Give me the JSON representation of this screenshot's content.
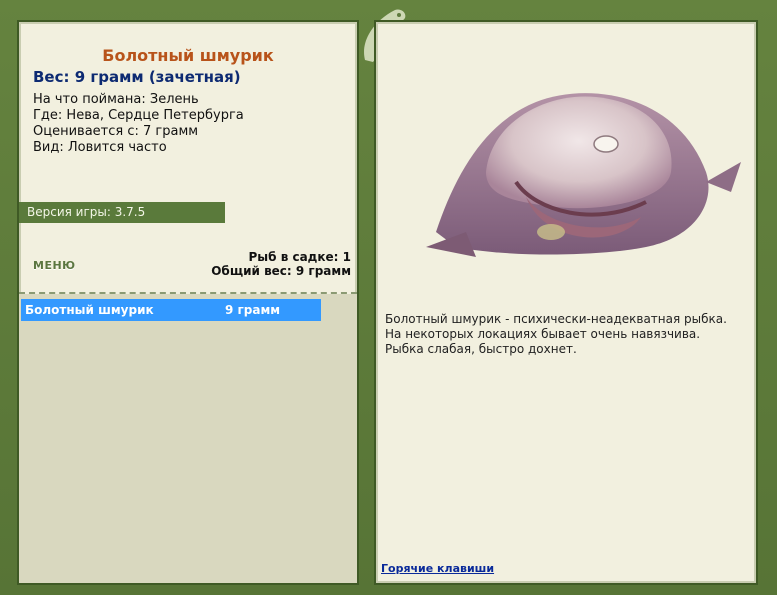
{
  "fish": {
    "title": "Болотный шмурик",
    "weight_line": "Вес: 9 грамм (зачетная)",
    "info": [
      "На что поймана: Зелень",
      "Где: Нева, Сердце Петербурга",
      "Оценивается с: 7 грамм",
      "Вид: Ловится часто"
    ]
  },
  "version": "Версия игры: 3.7.5",
  "menu_label": "МЕНЮ",
  "stats": {
    "fish_count": "Рыб в садке: 1",
    "total_weight": "Общий вес: 9 грамм"
  },
  "catch_list": [
    {
      "name": "Болотный шмурик",
      "weight": "9 грамм"
    }
  ],
  "description": [
    "Болотный шмурик - психически-неадекватная рыбка.",
    "На некоторых локациях бывает очень навязчива.",
    "Рыбка слабая, быстро дохнет."
  ],
  "hotkeys_label": "Горячие клавиши",
  "colors": {
    "frame": "#5e7a3e",
    "panel": "#f2f0df",
    "title": "#b8531a",
    "weight": "#0d2a72",
    "selected_row": "#3399ff"
  }
}
